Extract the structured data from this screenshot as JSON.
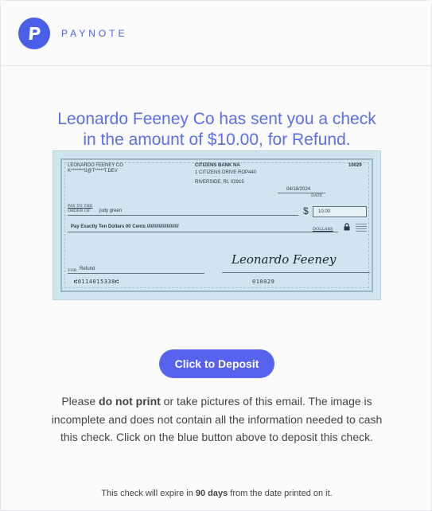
{
  "brand": {
    "name": "PAYNOTE",
    "logo_letter": "P",
    "accent": "#4a5fe8"
  },
  "headline": {
    "line1": "Leonardo Feeney Co has sent you a check",
    "line2": "in the amount of $10.00, for Refund."
  },
  "check": {
    "payer_name": "LEONARDO FEENEY CO",
    "payer_email": "K*******S@T*****T.DEV",
    "bank_name": "CITIZENS BANK NA",
    "bank_address1": "1 CITIZENS DRIVE  ROP440",
    "bank_address2": "RIVERSIDE, RI, 02915",
    "check_number": "10029",
    "date": "04/18/2024",
    "date_label": "DATE",
    "pay_to_label1": "PAY TO THE",
    "pay_to_label2": "ORDER OF",
    "payee": "judy green",
    "dollar_sign": "$",
    "amount": "10.00",
    "amount_words": "Pay Exactly  Ten Dollars 00 Cents ////////////////////////",
    "dollars_label": "DOLLARS",
    "memo_label": "FOR",
    "memo": "Refund",
    "signature": "Leonardo Feeney",
    "micr_routing": "⑆0114015338⑆",
    "micr_account": "010029"
  },
  "deposit_button": {
    "label": "Click to Deposit"
  },
  "notice": {
    "part1": "Please ",
    "bold": "do not print",
    "part2": " or take pictures of this email. The image is incomplete and does not contain all the information needed to cash this check. Click on the blue button above to deposit this check."
  },
  "expire": {
    "part1": "This check will expire in ",
    "bold": "90 days",
    "part2": " from the date printed on it."
  }
}
